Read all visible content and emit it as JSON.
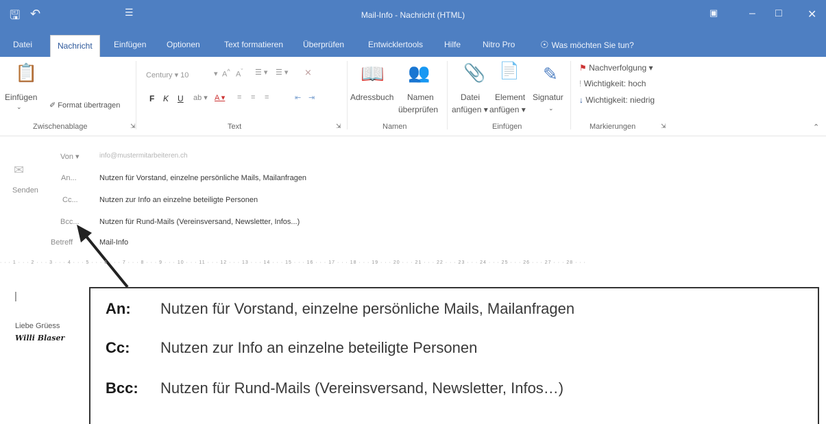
{
  "window": {
    "title": "Mail-Info - Nachricht (HTML)",
    "save_icon": "save-icon",
    "undo_icon": "undo-icon"
  },
  "tabs": [
    {
      "label": "Datei"
    },
    {
      "label": "Nachricht",
      "active": true
    },
    {
      "label": "Einfügen"
    },
    {
      "label": "Optionen"
    },
    {
      "label": "Text formatieren"
    },
    {
      "label": "Überprüfen"
    },
    {
      "label": "Entwicklertools"
    },
    {
      "label": "Hilfe"
    },
    {
      "label": "Nitro Pro"
    },
    {
      "label": "Was möchten Sie tun?"
    }
  ],
  "ribbon": {
    "clipboard": {
      "paste": "Einfügen",
      "format_painter": "Format übertragen",
      "group": "Zwischenablage"
    },
    "text": {
      "font": "Century",
      "size": "10",
      "bold": "F",
      "italic": "K",
      "underline": "U",
      "group": "Text"
    },
    "names": {
      "address_book": "Adressbuch",
      "check_names_1": "Namen",
      "check_names_2": "überprüfen",
      "group": "Namen"
    },
    "include": {
      "attach_file_1": "Datei",
      "attach_file_2": "anfügen",
      "attach_item_1": "Element",
      "attach_item_2": "anfügen",
      "signature": "Signatur",
      "group": "Einfügen"
    },
    "tags": {
      "follow_up": "Nachverfolgung",
      "high_importance": "Wichtigkeit: hoch",
      "low_importance": "Wichtigkeit: niedrig",
      "group": "Markierungen"
    }
  },
  "compose": {
    "send": "Senden",
    "from_label": "Von",
    "from_value": "info@mustermitarbeiteren.ch",
    "to_label": "An...",
    "to_value": "Nutzen für Vorstand, einzelne persönliche Mails, Mailanfragen",
    "cc_label": "Cc...",
    "cc_value": "Nutzen zur Info an einzelne beteiligte Personen",
    "bcc_label": "Bcc...",
    "bcc_value": "Nutzen für Rund-Mails (Vereinsversand, Newsletter, Infos...)",
    "subject_label": "Betreff",
    "subject_value": "Mail-Info"
  },
  "ruler_text": "· · · 1 · · · 2 · · · 3 · · · 4 · · · 5 · · · 6 · · · 7 · · · 8 · · · 9 · · · 10 · · · 11 · · · 12 · · · 13 · · · 14 · · · 15 · · · 16 · · · 17 · · · 18 · · · 19 · · · 20 · · · 21 · · · 22 · · · 23 · · · 24 · · · 25 · · · 26 · · · 27 · · · 28 · · ·",
  "body": {
    "greeting": "Liebe Grüess",
    "signature": "Willi Blaser"
  },
  "annotation": {
    "an_key": "An:",
    "an_text": "Nutzen für Vorstand, einzelne persönliche Mails, Mailanfragen",
    "cc_key": "Cc:",
    "cc_text": "Nutzen zur Info an einzelne beteiligte Personen",
    "bcc_key": "Bcc:",
    "bcc_text": "Nutzen für Rund-Mails (Vereinsversand, Newsletter, Infos…)"
  },
  "colors": {
    "title_bar": "#4e7fc2",
    "accent": "#2b579a"
  }
}
